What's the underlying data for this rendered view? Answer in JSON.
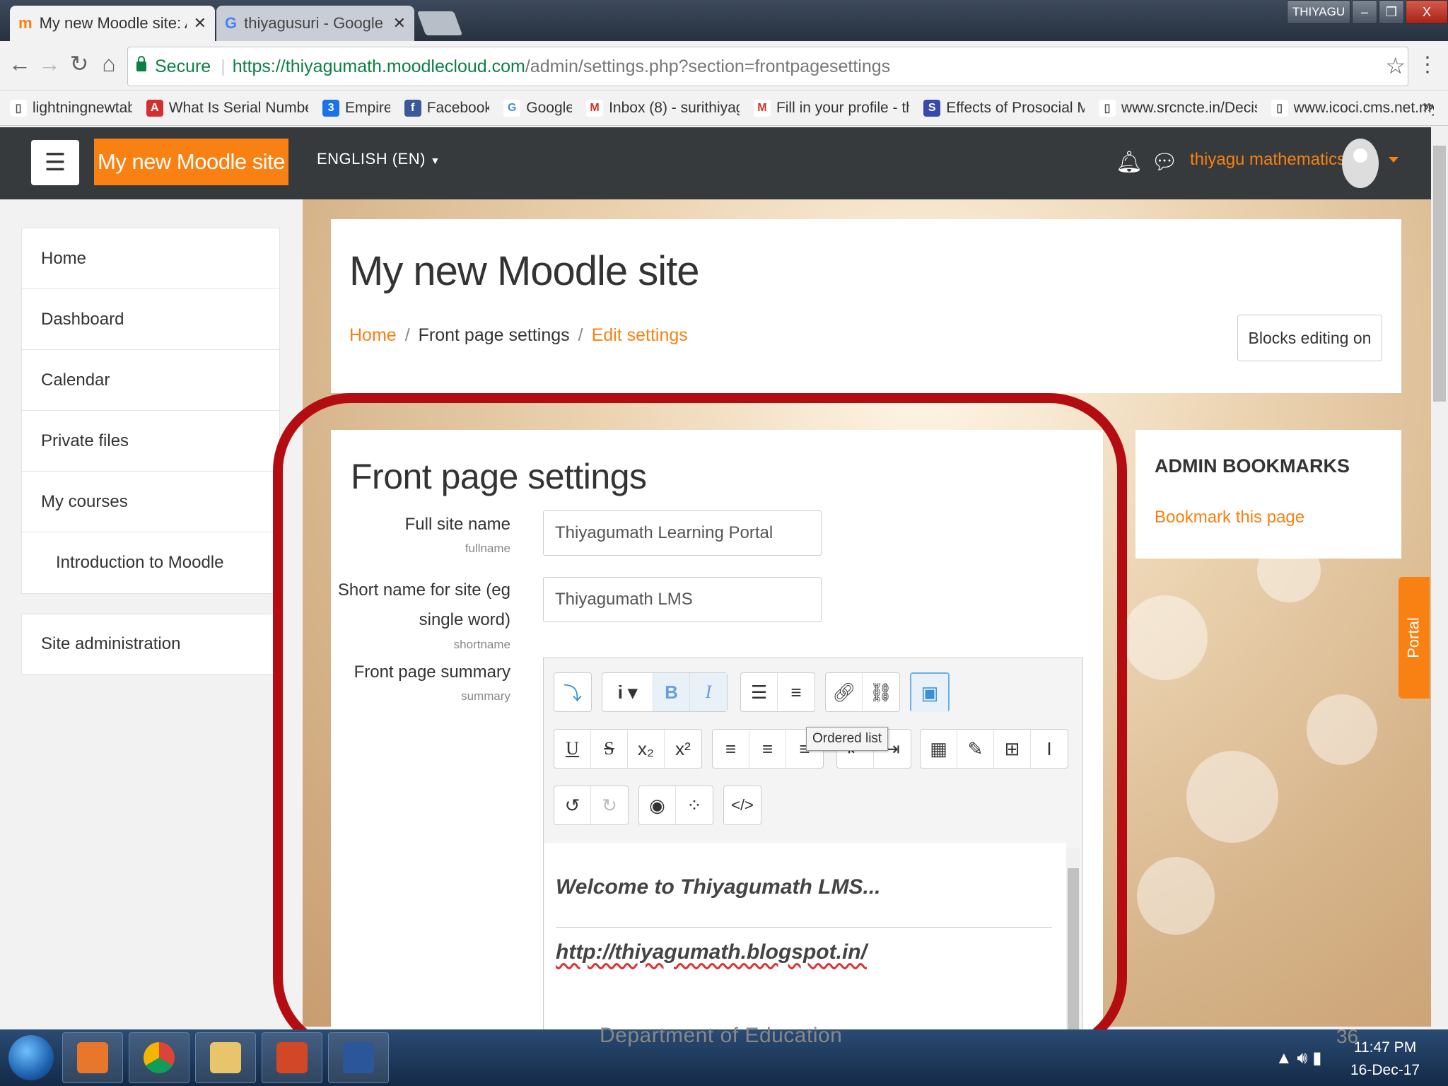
{
  "browser": {
    "tabs": [
      {
        "title": "My new Moodle site: Adr",
        "active": true
      },
      {
        "title": "thiyagusuri - Google Sea",
        "active": false
      }
    ],
    "user_badge": "THIYAGU",
    "secure_label": "Secure",
    "url_host": "https://thiyagumath.moodlecloud.com",
    "url_path": "/admin/settings.php?section=frontpagesettings",
    "bookmarks": [
      {
        "label": "lightningnewtab",
        "icon": "page-icon",
        "color": "#ffffff"
      },
      {
        "label": "What Is Serial Numbe",
        "icon": "ask-icon",
        "color": "#d32f2f"
      },
      {
        "label": "Empire",
        "icon": "empire-icon",
        "color": "#1a73e8"
      },
      {
        "label": "Facebook",
        "icon": "facebook-icon",
        "color": "#3b5998"
      },
      {
        "label": "Google",
        "icon": "google-icon",
        "color": "#ffffff"
      },
      {
        "label": "Inbox (8) - surithiyag",
        "icon": "gmail-icon",
        "color": "#ffffff"
      },
      {
        "label": "Fill in your profile - th",
        "icon": "gmail-icon",
        "color": "#ffffff"
      },
      {
        "label": "Effects of Prosocial M",
        "icon": "s-icon",
        "color": "#3949ab"
      },
      {
        "label": "www.srcncte.in/Decis",
        "icon": "page-icon",
        "color": "#ffffff"
      },
      {
        "label": "www.icoci.cms.net.my",
        "icon": "page-icon",
        "color": "#ffffff"
      }
    ]
  },
  "navbar": {
    "brand": "My new Moodle site",
    "language": "ENGLISH (EN)",
    "username": "thiyagu mathematics",
    "accent": "#f98012"
  },
  "sidebar": {
    "items": [
      "Home",
      "Dashboard",
      "Calendar",
      "Private files",
      "My courses",
      "Introduction to Moodle"
    ],
    "site_admin": "Site administration"
  },
  "header": {
    "title": "My new Moodle site",
    "breadcrumb": {
      "home": "Home",
      "sep": "/",
      "middle": "Front page settings",
      "current": "Edit settings"
    },
    "blocks_button": "Blocks editing on"
  },
  "form": {
    "section_title": "Front page settings",
    "fullname": {
      "label": "Full site name",
      "sub": "fullname",
      "value": "Thiyagumath Learning Portal"
    },
    "shortname": {
      "label_line1": "Short name for site (eg",
      "label_line2": "single word)",
      "sub": "shortname",
      "value": "Thiyagumath LMS"
    },
    "summary": {
      "label": "Front page summary",
      "sub": "summary"
    }
  },
  "editor": {
    "tooltip": "Ordered list",
    "content_line1": "Welcome to Thiyagumath LMS...",
    "content_line2": "http://thiyagumath.blogspot.in/"
  },
  "admin_bookmarks": {
    "title": "ADMIN BOOKMARKS",
    "link": "Bookmark this page"
  },
  "portal_tab": "Portal",
  "slide": {
    "footer": "Department of Education",
    "number": "36"
  },
  "taskbar": {
    "time": "11:47 PM",
    "date": "16-Dec-17"
  },
  "annotation_color": "#b40d11"
}
